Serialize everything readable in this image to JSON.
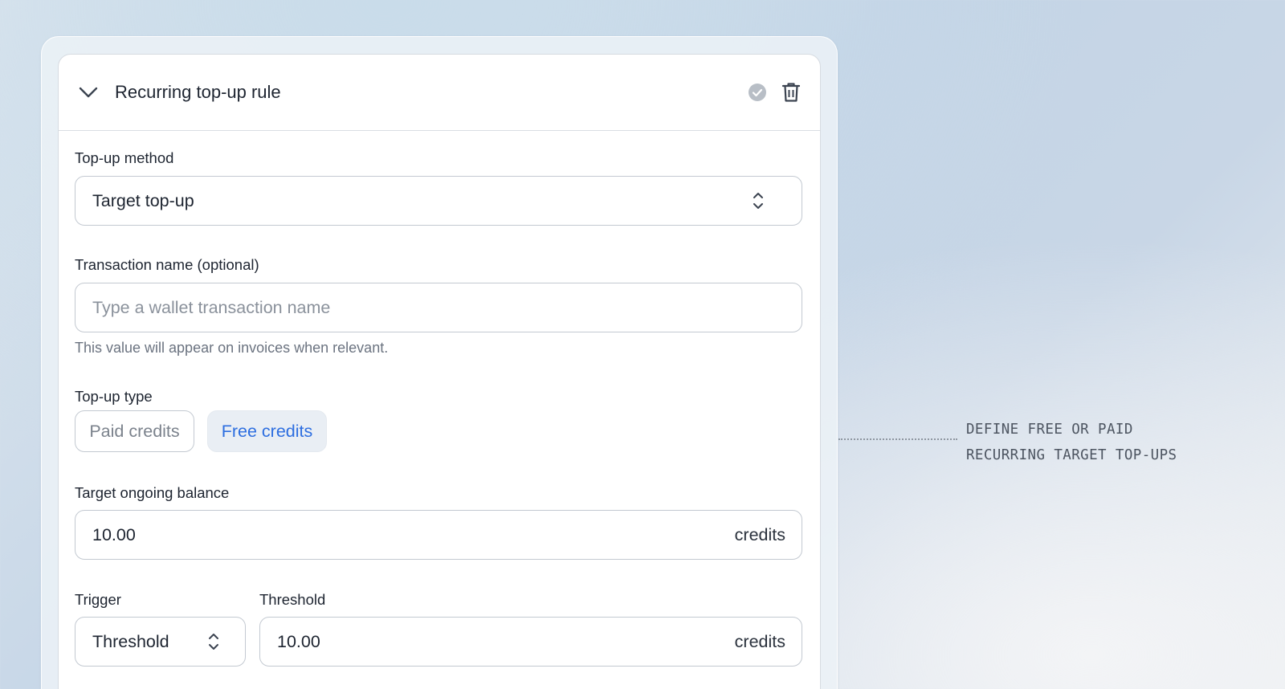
{
  "rule": {
    "title": "Recurring top-up rule",
    "icons": {
      "collapse": "chevron-down-icon",
      "status": "check-circle-icon",
      "delete": "trash-icon"
    }
  },
  "form": {
    "method": {
      "label": "Top-up method",
      "value": "Target top-up"
    },
    "transaction_name": {
      "label": "Transaction name (optional)",
      "value": "",
      "placeholder": "Type a wallet transaction name",
      "helper": "This value will appear on invoices when relevant."
    },
    "topup_type": {
      "label": "Top-up type",
      "options": [
        {
          "label": "Paid credits",
          "selected": false
        },
        {
          "label": "Free credits",
          "selected": true
        }
      ]
    },
    "target_balance": {
      "label": "Target ongoing balance",
      "value": "10.00",
      "unit": "credits"
    },
    "trigger": {
      "label": "Trigger",
      "value": "Threshold"
    },
    "threshold": {
      "label": "Threshold",
      "value": "10.00",
      "unit": "credits"
    }
  },
  "annotation": {
    "line1": "DEFINE FREE OR PAID",
    "line2": "RECURRING TARGET TOP-UPS"
  },
  "colors": {
    "accent": "#2d6ee0",
    "selected_chip_bg": "#e9eef4",
    "border": "#c3c9d1",
    "text": "#1d2430"
  }
}
